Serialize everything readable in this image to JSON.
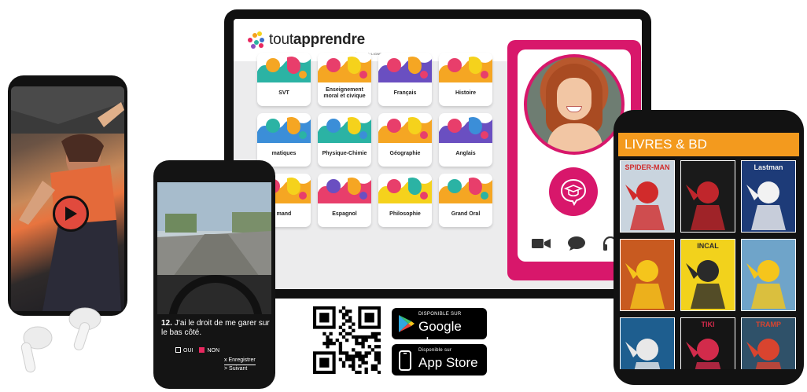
{
  "brand": {
    "name_light": "tout",
    "name_bold": "apprendre",
    "tagline": "1ʳᵉ BIBLIOTHÈQUE EN LIGNE",
    "dot_colors": [
      "#e8285f",
      "#f4a11e",
      "#2bb3a4",
      "#3b6ec9",
      "#8d4fc1",
      "#f5d21c"
    ]
  },
  "subjects": [
    {
      "label": "SVT",
      "colors": [
        "#2bb3a4",
        "#f5a623",
        "#e83e6b"
      ]
    },
    {
      "label": "Enseignement moral et civique",
      "colors": [
        "#f5a623",
        "#e83e6b",
        "#f5d21c"
      ]
    },
    {
      "label": "Français",
      "colors": [
        "#6a4fc1",
        "#e83e6b",
        "#f5a623"
      ]
    },
    {
      "label": "Histoire",
      "colors": [
        "#f5a623",
        "#e83e6b",
        "#f5d21c"
      ]
    },
    {
      "label": "matiques",
      "colors": [
        "#3b8ed8",
        "#2bb3a4",
        "#f5a623"
      ]
    },
    {
      "label": "Physique-Chimie",
      "colors": [
        "#2bb3a4",
        "#3b8ed8",
        "#f5d21c"
      ]
    },
    {
      "label": "Géographie",
      "colors": [
        "#f5a623",
        "#e83e6b",
        "#f5d21c"
      ]
    },
    {
      "label": "Anglais",
      "colors": [
        "#6a4fc1",
        "#e83e6b",
        "#3b8ed8"
      ]
    },
    {
      "label": "mand",
      "colors": [
        "#f5a623",
        "#e83e6b",
        "#f5d21c"
      ]
    },
    {
      "label": "Espagnol",
      "colors": [
        "#e83e6b",
        "#6a4fc1",
        "#f5a623"
      ]
    },
    {
      "label": "Philosophie",
      "colors": [
        "#f5d21c",
        "#e83e6b",
        "#2bb3a4"
      ]
    },
    {
      "label": "Grand Oral",
      "colors": [
        "#f5a623",
        "#2bb3a4",
        "#e83e6b"
      ]
    }
  ],
  "tutor": {
    "accent": "#d8176b",
    "action_icons": [
      "video-camera-icon",
      "chat-bubble-icon",
      "headphones-icon"
    ],
    "center_icon": "graduation-cap-icon"
  },
  "video": {
    "icon": "play-icon"
  },
  "quiz": {
    "number": "12.",
    "question": "J'ai le droit de me garer sur le bas côté.",
    "options": [
      {
        "label": "OUI",
        "color": "#ffffff"
      },
      {
        "label": "NON",
        "color": "#e8285f"
      }
    ],
    "save": "x Enregistrer",
    "next": "> Suivant"
  },
  "stores": {
    "google": {
      "small": "DISPONIBLE SUR",
      "big": "Google play"
    },
    "apple": {
      "small": "Disponible sur",
      "big": "App Store"
    }
  },
  "library": {
    "title": "LIVRES & BD",
    "accent": "#f39a1e",
    "covers": [
      {
        "label": "SPIDER-MAN",
        "bg": "#c9d4de",
        "fg": "#d12b2b"
      },
      {
        "label": "",
        "bg": "#1a1a1a",
        "fg": "#c0262c"
      },
      {
        "label": "Lastman",
        "bg": "#1d3b78",
        "fg": "#f2f2f2"
      },
      {
        "label": "",
        "bg": "#c85a20",
        "fg": "#f5c51c"
      },
      {
        "label": "INCAL",
        "bg": "#f2d21c",
        "fg": "#2a2a2a"
      },
      {
        "label": "",
        "bg": "#6fa4c9",
        "fg": "#f5c51c"
      },
      {
        "label": "",
        "bg": "#1e5e8f",
        "fg": "#e8e8e8"
      },
      {
        "label": "TIKI",
        "bg": "#151515",
        "fg": "#d22b4b"
      },
      {
        "label": "TRAMP",
        "bg": "#2f5169",
        "fg": "#d9442f"
      }
    ]
  }
}
